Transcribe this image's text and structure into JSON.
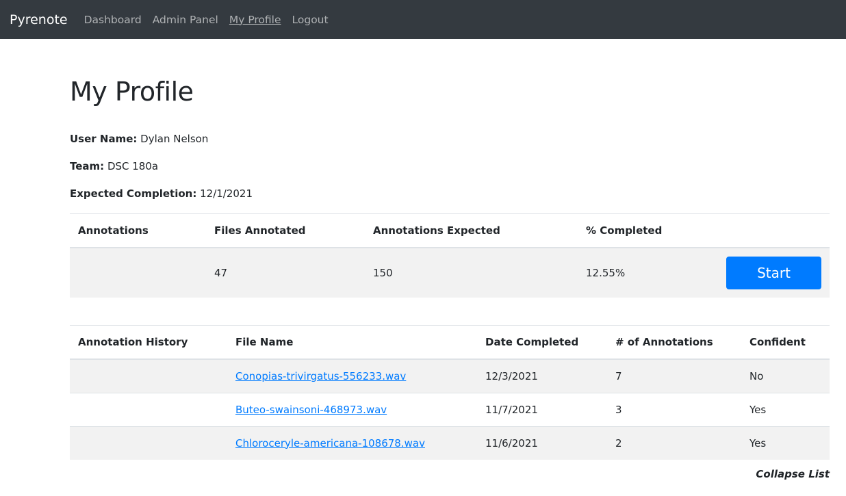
{
  "nav": {
    "brand": "Pyrenote",
    "items": [
      "Dashboard",
      "Admin Panel",
      "My Profile",
      "Logout"
    ]
  },
  "page": {
    "title": "My Profile"
  },
  "profile": {
    "user_name_label": "User Name:",
    "user_name": "Dylan Nelson",
    "team_label": "Team:",
    "team": "DSC 180a",
    "completion_label": "Expected Completion:",
    "completion": "12/1/2021"
  },
  "annotations": {
    "headers": [
      "Annotations",
      "Files Annotated",
      "Annotations Expected",
      "% Completed"
    ],
    "files_annotated": "47",
    "expected": "150",
    "completed": "12.55%",
    "start_label": "Start"
  },
  "history": {
    "headers": [
      "Annotation History",
      "File Name",
      "Date Completed",
      "# of Annotations",
      "Confident"
    ],
    "rows": [
      {
        "file": "Conopias-trivirgatus-556233.wav",
        "date": "12/3/2021",
        "count": "7",
        "confident": "No"
      },
      {
        "file": "Buteo-swainsoni-468973.wav",
        "date": "11/7/2021",
        "count": "3",
        "confident": "Yes"
      },
      {
        "file": "Chloroceryle-americana-108678.wav",
        "date": "11/6/2021",
        "count": "2",
        "confident": "Yes"
      }
    ],
    "collapse_label": "Collapse List"
  }
}
